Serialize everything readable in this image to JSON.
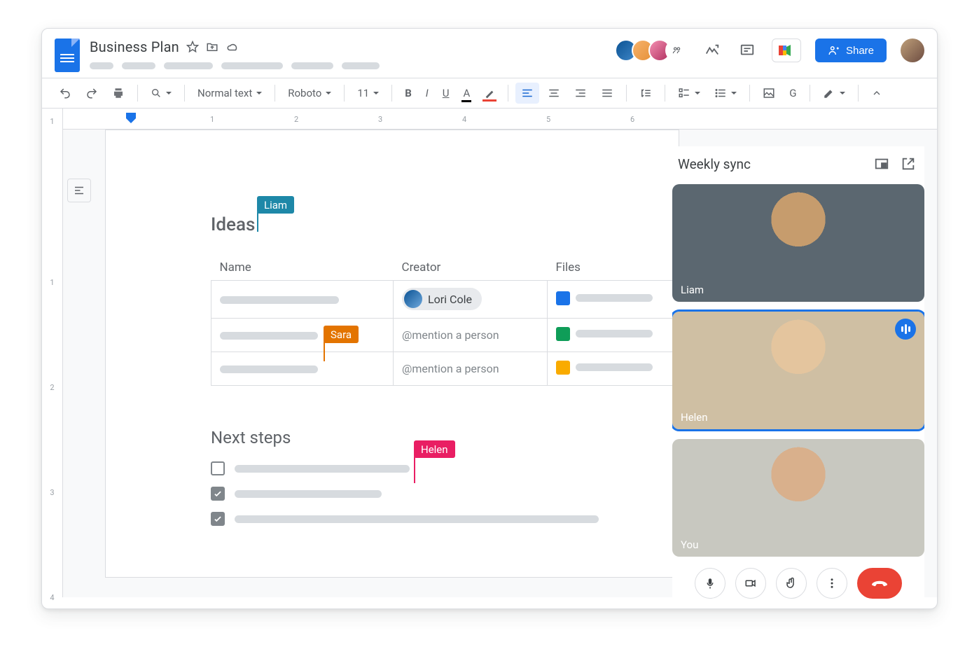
{
  "header": {
    "doc_title": "Business Plan",
    "share_label": "Share"
  },
  "toolbar": {
    "style": "Normal text",
    "font": "Roboto",
    "size": "11"
  },
  "doc": {
    "ideas_heading": "Ideas",
    "columns": {
      "name": "Name",
      "creator": "Creator",
      "files": "Files"
    },
    "creator_chip": "Lori Cole",
    "mention_ph": "@mention a person",
    "next_heading": "Next steps",
    "cursors": {
      "liam": "Liam",
      "sara": "Sara",
      "helen": "Helen"
    }
  },
  "meet": {
    "title": "Weekly sync",
    "tiles": {
      "liam": "Liam",
      "helen": "Helen",
      "you": "You"
    }
  }
}
